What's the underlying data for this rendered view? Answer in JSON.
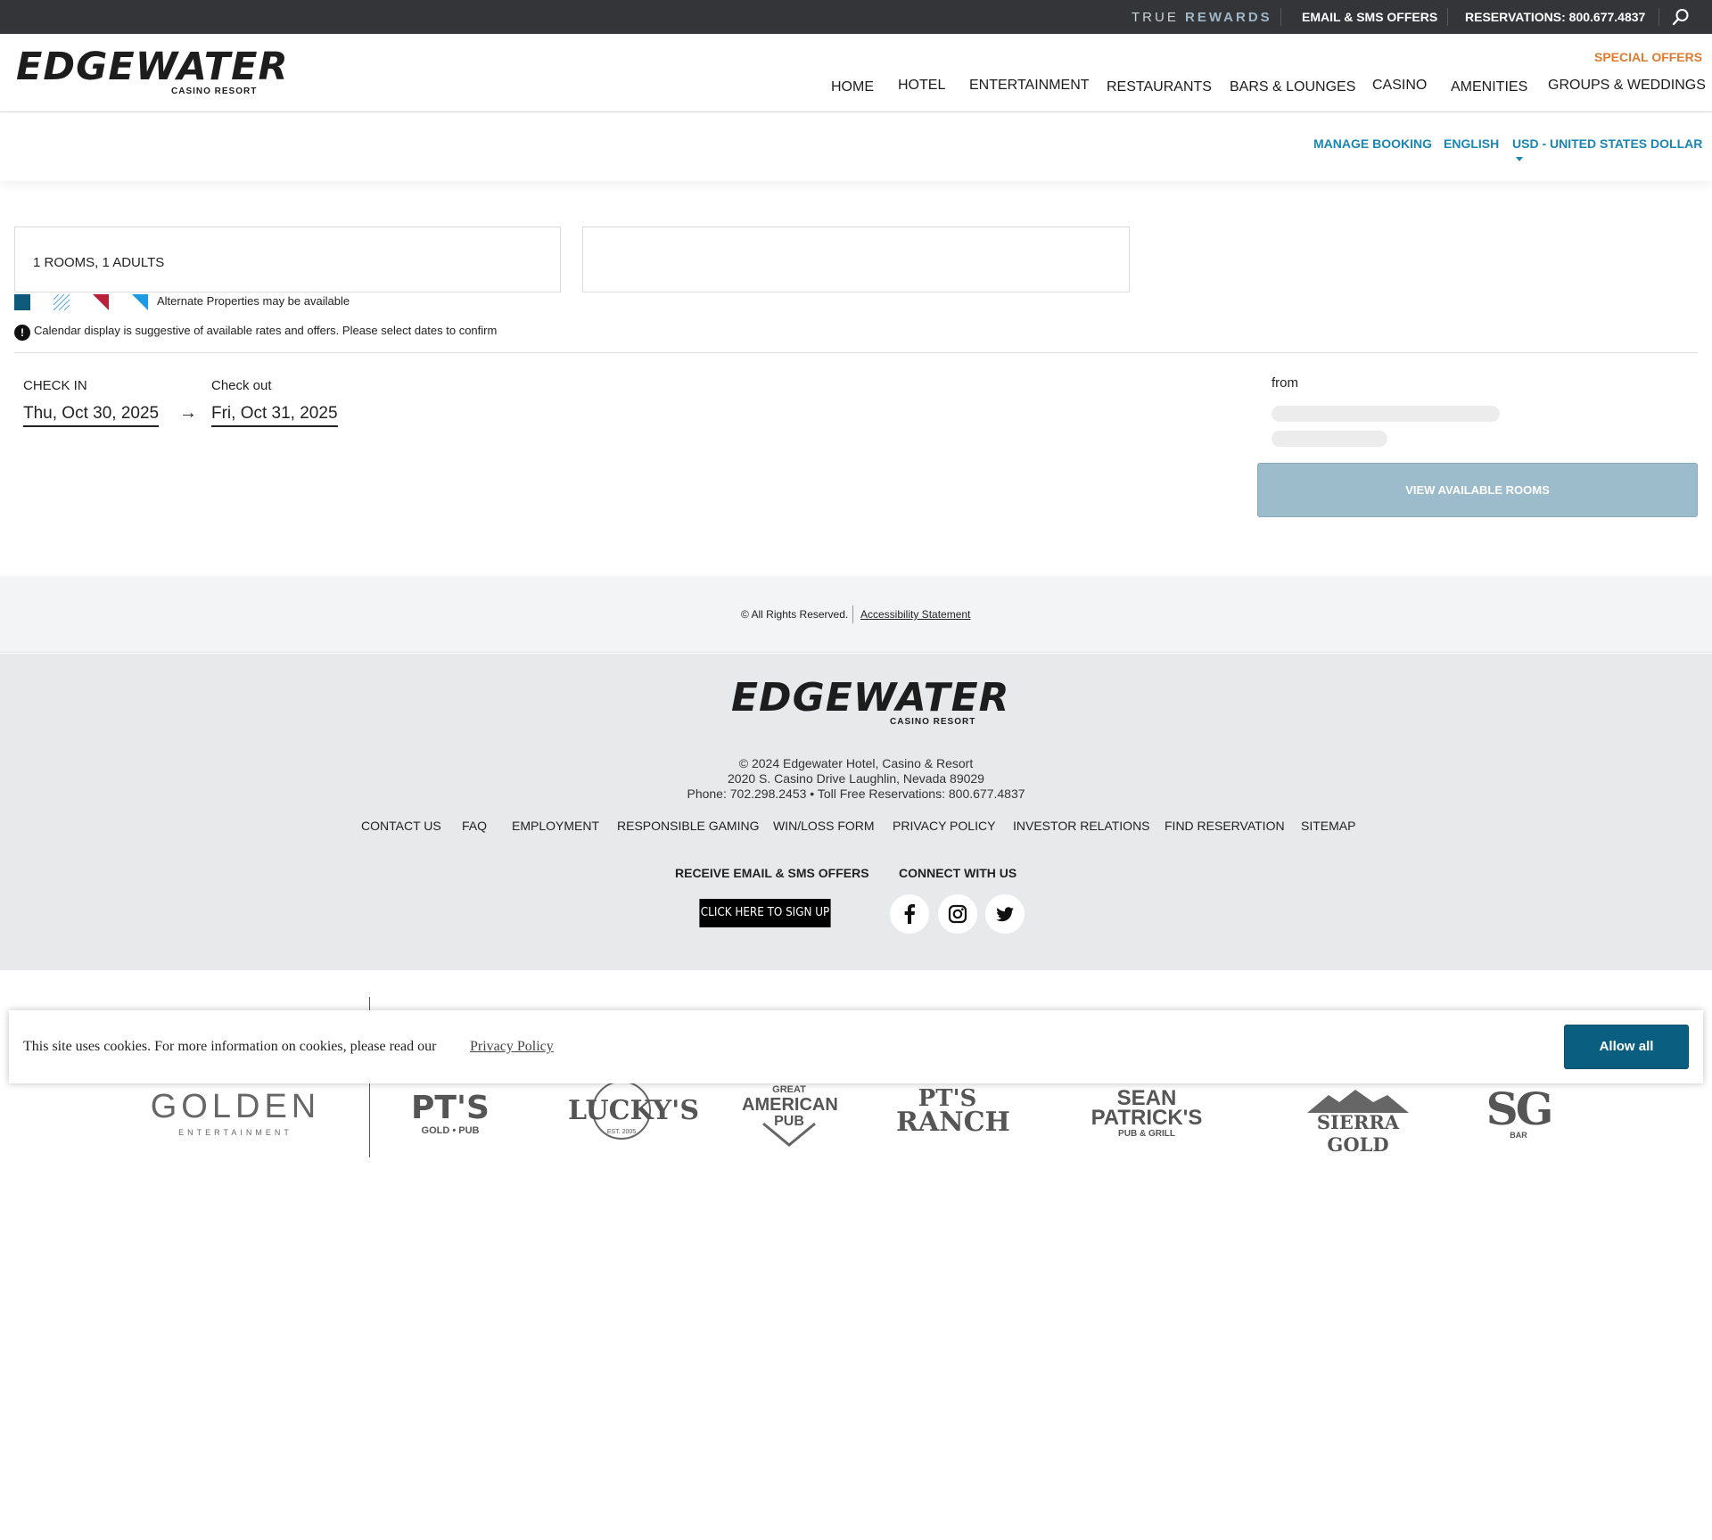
{
  "topbar": {
    "rewards_prefix": "TRUE",
    "rewards_suffix": "REWARDS",
    "email_offers": "EMAIL & SMS OFFERS",
    "reservations": "RESERVATIONS: 800.677.4837",
    "icon": "search-icon"
  },
  "header": {
    "logo_main": "EDGEWATER",
    "logo_sub": "CASINO RESORT",
    "special_offers": "SPECIAL OFFERS",
    "nav": [
      "HOME",
      "HOTEL",
      "ENTERTAINMENT",
      "RESTAURANTS",
      "BARS & LOUNGES",
      "CASINO",
      "AMENITIES",
      "GROUPS & WEDDINGS"
    ]
  },
  "subbar": {
    "manage_booking": "MANAGE BOOKING",
    "language": "ENGLISH",
    "currency": "USD - UNITED STATES DOLLAR"
  },
  "booking": {
    "rooms_guests": "1 ROOMS, 1 ADULTS",
    "second_field": "",
    "legend_alternate": "Alternate Properties may be available",
    "calendar_notice": "Calendar display is suggestive of available rates and offers. Please select dates to confirm",
    "checkin_label": "CHECK IN",
    "checkin_date": "Thu, Oct 30, 2025",
    "checkout_label": "Check out",
    "checkout_date": "Fri, Oct 31, 2025",
    "from_label": "from",
    "view_rooms": "VIEW AVAILABLE ROOMS"
  },
  "rights": {
    "copyright": "© All Rights Reserved.",
    "accessibility": "Accessibility Statement"
  },
  "footer": {
    "logo_main": "EDGEWATER",
    "logo_sub": "CASINO RESORT",
    "address_line1": "© 2024 Edgewater Hotel, Casino & Resort",
    "address_line2": "2020 S. Casino Drive Laughlin, Nevada 89029",
    "address_line3": "Phone: 702.298.2453 • Toll Free Reservations: 800.677.4837",
    "links": [
      "CONTACT US",
      "FAQ",
      "EMPLOYMENT",
      "RESPONSIBLE GAMING",
      "WIN/LOSS FORM",
      "PRIVACY POLICY",
      "INVESTOR RELATIONS",
      "FIND RESERVATION",
      "SITEMAP"
    ],
    "email_heading": "RECEIVE EMAIL & SMS OFFERS",
    "connect_heading": "CONNECT WITH US",
    "signup": "CLICK HERE TO SIGN UP",
    "social": [
      "facebook-icon",
      "instagram-icon",
      "twitter-icon"
    ]
  },
  "brands": {
    "golden_main": "GOLDEN",
    "golden_sub": "ENTERTAINMENT",
    "pts_gold_main": "PT'S",
    "pts_gold_sub": "GOLD • PUB",
    "luckys_main": "LUCKY'S",
    "luckys_sub": "EST. 2005",
    "gap_line1": "GREAT",
    "gap_line2": "AMERICAN",
    "gap_line3": "PUB",
    "pts_ranch_line1": "PT'S",
    "pts_ranch_line2": "RANCH",
    "sean_line1": "SEAN",
    "sean_line2": "PATRICK'S",
    "sean_line3": "PUB & GRILL",
    "sierra": "SIERRA GOLD",
    "sg_main": "SG",
    "sg_sub": "BAR"
  },
  "cookie": {
    "text": "This site uses cookies. For more information on cookies, please read our",
    "link": "Privacy Policy",
    "button": "Allow all"
  },
  "colors": {
    "accent_blue": "#1a86b3",
    "special_orange": "#e07b2e",
    "button_disabled": "#9cbccc",
    "cookie_button": "#0a5f80"
  }
}
